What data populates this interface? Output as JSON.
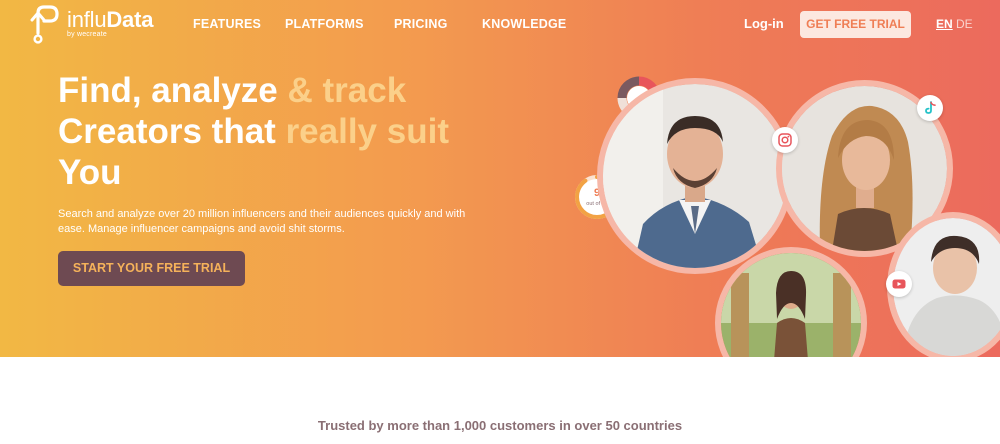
{
  "brand": {
    "name_light": "influ",
    "name_bold": "Data",
    "subline": "by wecreate"
  },
  "nav": {
    "links": [
      "FEATURES",
      "PLATFORMS",
      "PRICING",
      "KNOWLEDGE"
    ],
    "login": "Log-in",
    "trial_button": "GET FREE TRIAL",
    "languages": {
      "active": "EN",
      "inactive": "DE"
    }
  },
  "hero": {
    "headline": {
      "line1_a": "Find, analyze ",
      "line1_b": "& track",
      "line2_a": "Creators that ",
      "line2_b": "really suit",
      "line3": "You"
    },
    "description": "Search and analyze over 20 million influencers and their audiences quickly and with ease. Manage influencer campaigns and avoid shit storms.",
    "cta": "START YOUR FREE TRIAL",
    "score_widget": {
      "score": "9",
      "label": "out of 10",
      "fraction": 0.9
    }
  },
  "social_icons": [
    "instagram-icon",
    "tiktok-icon",
    "youtube-icon"
  ],
  "colors": {
    "gradient_start": "#f2b844",
    "gradient_end": "#ec6a5d",
    "cta_bg": "#6e4a52",
    "cta_text": "#f5b25a",
    "ring": "#f6b7a7"
  },
  "trusted": "Trusted by more than 1,000 customers in over 50 countries"
}
